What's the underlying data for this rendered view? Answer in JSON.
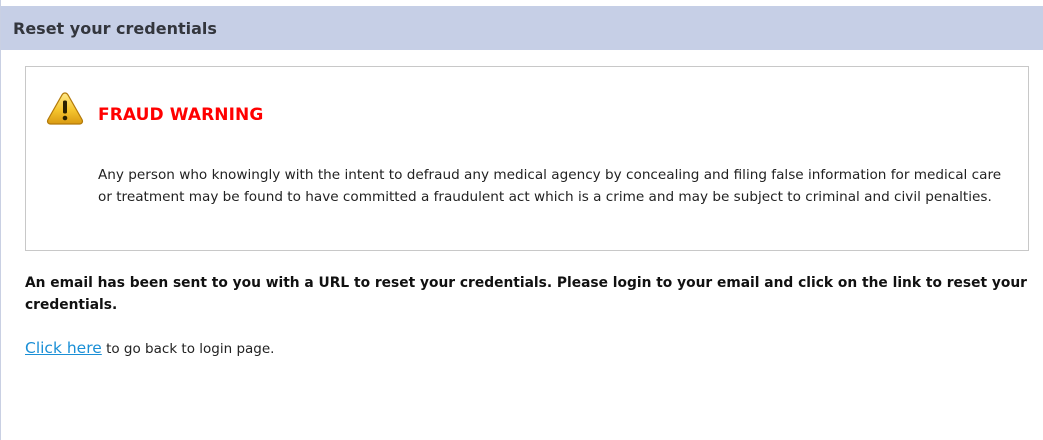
{
  "header": {
    "title": "Reset your credentials"
  },
  "warning": {
    "icon": "warning-triangle-icon",
    "title": "FRAUD WARNING",
    "title_color": "#ff0000",
    "text": "Any person who knowingly with the intent to defraud any medical agency by concealing and filing false information for medical care or treatment may be found to have committed a fraudulent act which is a crime and may be subject to criminal and civil penalties."
  },
  "message": {
    "text": "An email has been sent to you with a URL to reset your credentials. Please login to your email and click on the link to reset your credentials."
  },
  "back": {
    "link_label": "Click here",
    "suffix": " to go back to login page.",
    "link_color": "#1a8fd6"
  },
  "colors": {
    "header_bg": "#c6cfe6",
    "box_border": "#c8c8c8"
  }
}
